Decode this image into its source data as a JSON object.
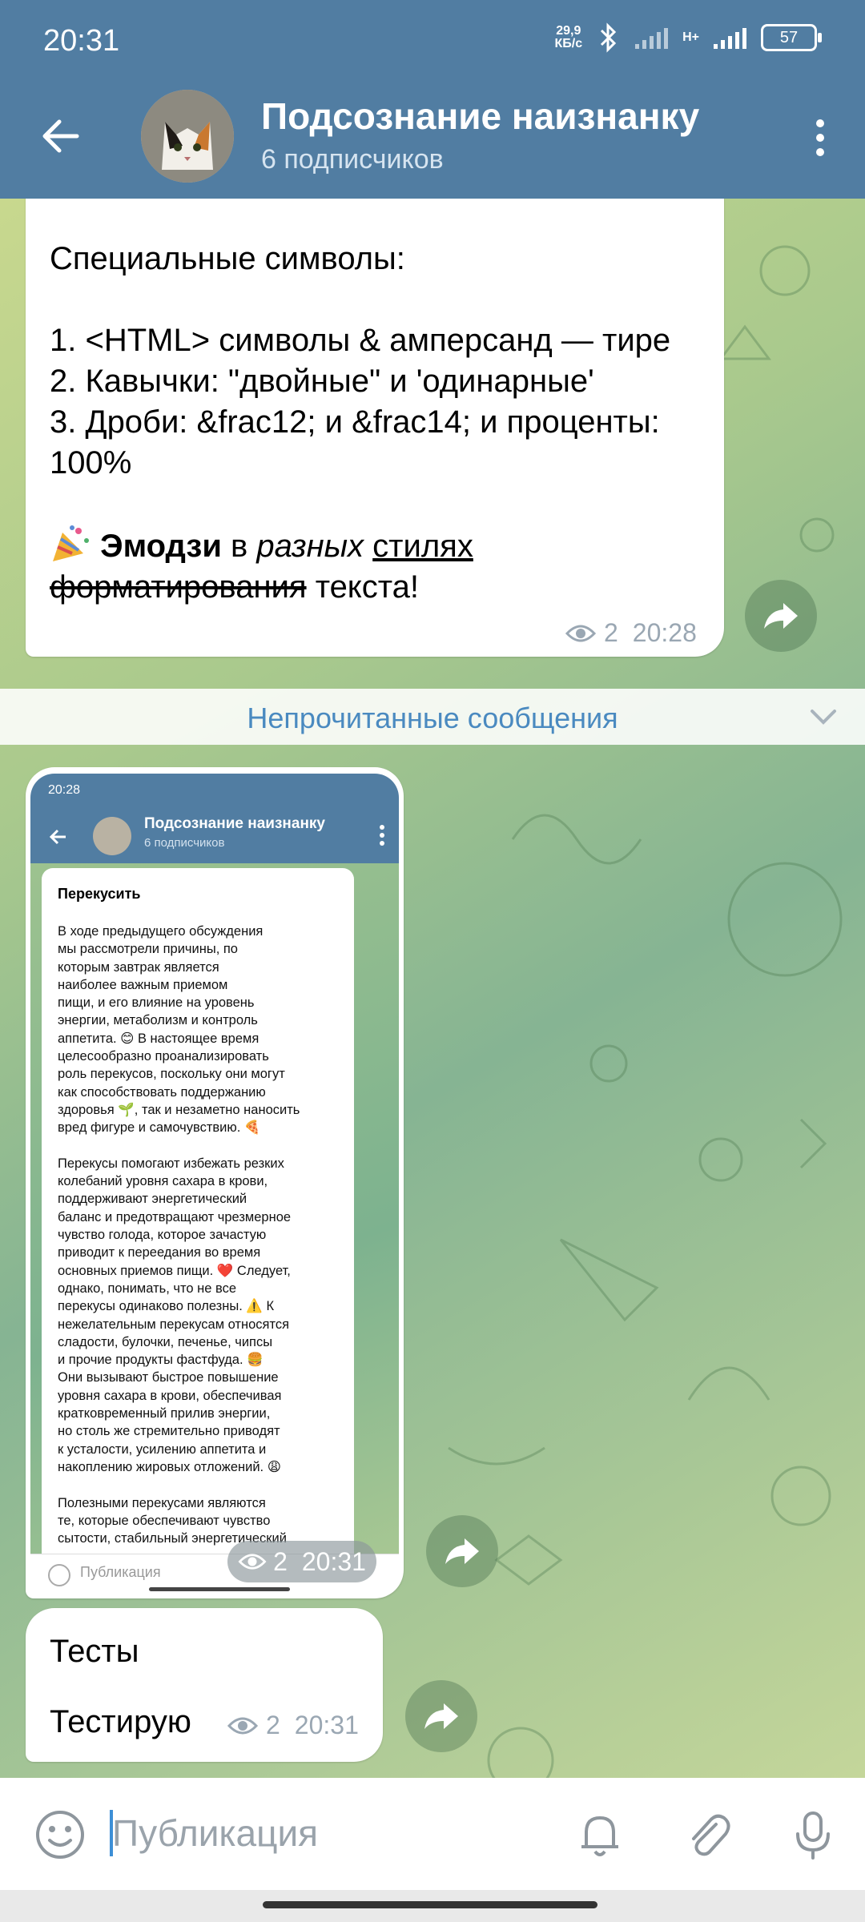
{
  "status": {
    "time": "20:31",
    "net_speed_top": "29,9",
    "net_speed_bottom": "КБ/с",
    "net_type": "H+",
    "battery": "57"
  },
  "header": {
    "title": "Подсознание наизнанку",
    "subtitle": "6 подписчиков"
  },
  "message1": {
    "heading": "Специальные символы:",
    "line1": "1. <HTML> символы & амперсанд — тире",
    "line2": "2. Кавычки: \"двойные\" и 'одинарные'",
    "line3": "3. Дроби: &frac12; и &frac14; и проценты: 100%",
    "bold": "Эмодзи",
    "plain1": " в ",
    "italic": "разных",
    "plain2": " ",
    "underline": "стилях",
    "strike": "форматирования",
    "plain3": " текста!",
    "views": "2",
    "time": "20:28"
  },
  "unread_label": "Непрочитанные сообщения",
  "message2": {
    "views": "2",
    "time": "20:31",
    "screenshot": {
      "time": "20:28",
      "title": "Подсознание наизнанку",
      "subtitle": "6 подписчиков",
      "heading": "Перекусить",
      "body": "В ходе предыдущего обсуждения\nмы рассмотрели причины, по\nкоторым завтрак является\nнаиболее важным приемом\nпищи, и его влияние на уровень\nэнергии, метаболизм и контроль\nаппетита. 😊 В настоящее время\nцелесообразно проанализировать\nроль перекусов, поскольку они могут\nкак способствовать поддержанию\nздоровья 🌱, так и незаметно наносить\nвред фигуре и самочувствию. 🍕\n\nПерекусы помогают избежать резких\nколебаний уровня сахара в крови,\nподдерживают энергетический\nбаланс и предотвращают чрезмерное\nчувство голода, которое зачастую\nприводит к переедания во время\nосновных приемов пищи. ❤️ Следует,\nоднако, понимать, что не все\nперекусы одинаково полезны. ⚠️ К\nнежелательным перекусам относятся\nсладости, булочки, печенье, чипсы\nи прочие продукты фастфуда. 🍔\nОни вызывают быстрое повышение\nуровня сахара в крови, обеспечивая\nкратковременный прилив энергии,\nно столь же стремительно приводят\nк усталости, усилению аппетита и\nнакоплению жировых отложений. 😩\n\nПолезными перекусами являются\nте, которые обеспечивают чувство\nсытости, стабильный энергетический",
      "input_placeholder": "Публикация"
    }
  },
  "message3": {
    "line1": "Тесты",
    "line2": "Тестирую",
    "views": "2",
    "time": "20:31"
  },
  "input": {
    "placeholder": "Публикация"
  },
  "icons": {
    "back": "arrow-left-icon",
    "menu": "more-vertical-icon",
    "share": "share-arrow-icon",
    "eye": "eye-icon",
    "emoji": "smile-icon",
    "bell": "bell-icon",
    "attach": "paperclip-icon",
    "mic": "microphone-icon"
  },
  "colors": {
    "header": "#517da2",
    "accent": "#4a8ac0",
    "meta": "#9aa7b3"
  }
}
